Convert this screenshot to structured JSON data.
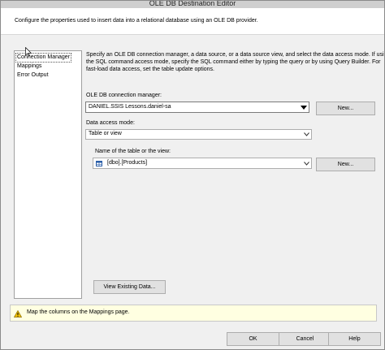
{
  "window": {
    "title": "OLE DB Destination Editor",
    "description": "Configure the properties used to insert data into a relational database using an OLE DB provider."
  },
  "nav": {
    "items": [
      {
        "label": "Connection Manager",
        "selected": true
      },
      {
        "label": "Mappings",
        "selected": false
      },
      {
        "label": "Error Output",
        "selected": false
      }
    ]
  },
  "main": {
    "intro_lines": [
      "Specify an OLE DB connection manager, a data source, or a data source view, and select the data access mode. If using",
      "the SQL command access mode, specify the SQL command either by typing the query or by using Query Builder. For",
      "fast-load data access, set the table update options."
    ],
    "connection_manager": {
      "label": "OLE DB connection manager:",
      "value": "DANIEL.SSIS Lessons.daniel-sa",
      "new_button": "New..."
    },
    "data_access_mode": {
      "label": "Data access mode:",
      "value": "Table or view"
    },
    "table": {
      "label": "Name of the table or the view:",
      "value": "[dbo].[Products]",
      "new_button": "New..."
    },
    "view_existing_button": "View Existing Data..."
  },
  "info_bar": {
    "message": "Map the columns on the Mappings page."
  },
  "footer": {
    "ok": "OK",
    "cancel": "Cancel",
    "help": "Help"
  },
  "icons": {
    "warning": "warning-icon",
    "table": "table-icon",
    "dropdown": "chevron-down-icon"
  }
}
